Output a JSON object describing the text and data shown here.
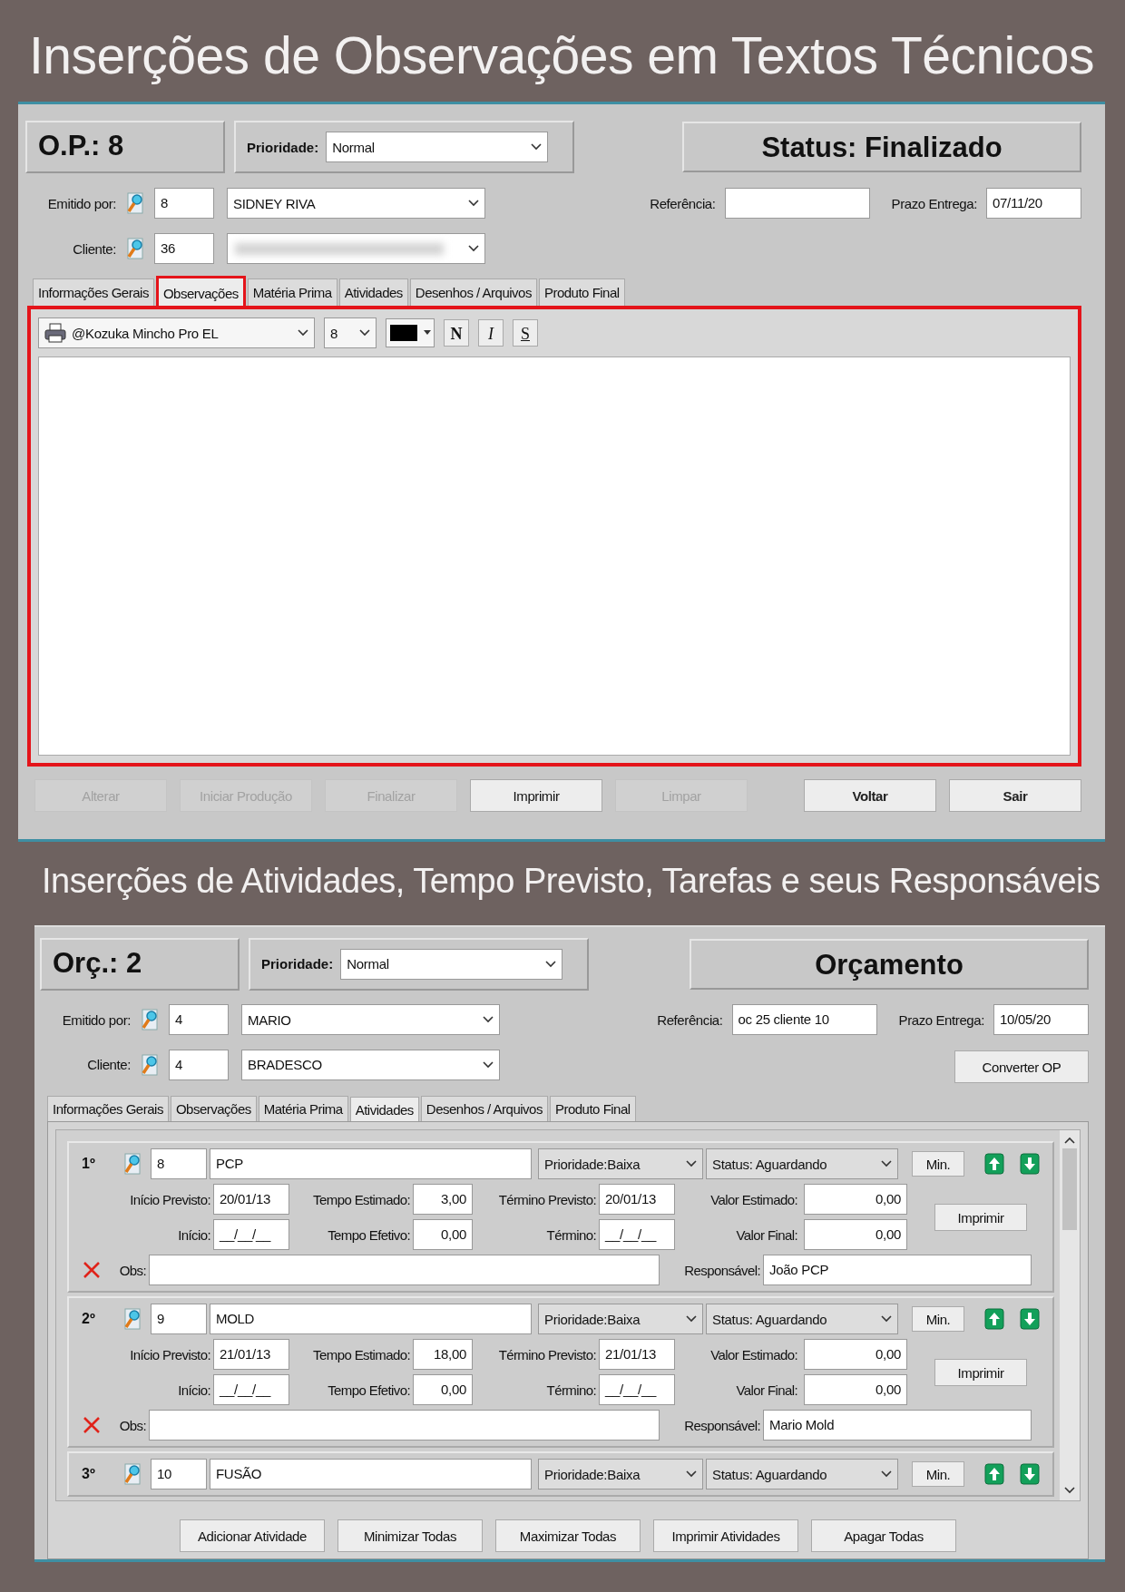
{
  "headline_top": "Inserções de Observações em Textos Técnicos",
  "order_window": {
    "number": "O.P.: 8",
    "priority": {
      "label": "Prioridade:",
      "value": "Normal"
    },
    "status": "Status: Finalizado",
    "issued_by": {
      "label": "Emitido por:",
      "code": "8",
      "name": "SIDNEY RIVA"
    },
    "client": {
      "label": "Cliente:",
      "code": "36",
      "blurred": true
    },
    "reference": {
      "label": "Referência:"
    },
    "deadline": {
      "label": "Prazo Entrega:",
      "value": "07/11/20"
    },
    "tabs": [
      {
        "label": "Informações Gerais",
        "selected": false,
        "highlighted": false
      },
      {
        "label": "Observações",
        "selected": true,
        "highlighted": true
      },
      {
        "label": "Matéria Prima",
        "selected": false,
        "highlighted": false
      },
      {
        "label": "Atividades",
        "selected": false,
        "highlighted": false
      },
      {
        "label": "Desenhos / Arquivos",
        "selected": false,
        "highlighted": false
      },
      {
        "label": "Produto Final",
        "selected": false,
        "highlighted": false
      }
    ],
    "editor": {
      "highlighted": true,
      "font": "@Kozuka Mincho Pro EL",
      "size": "8",
      "format_buttons": [
        {
          "label": "N",
          "kind": "bold"
        },
        {
          "label": "I",
          "kind": "italic"
        },
        {
          "label": "S",
          "kind": "underline"
        }
      ]
    },
    "buttons": [
      {
        "label": "Alterar",
        "disabled": true,
        "kind": "action"
      },
      {
        "label": "Iniciar Produção",
        "disabled": true,
        "kind": "action"
      },
      {
        "label": "Finalizar",
        "disabled": true,
        "kind": "action"
      },
      {
        "label": "Imprimir",
        "disabled": false,
        "kind": "action"
      },
      {
        "label": "Limpar",
        "disabled": true,
        "kind": "action"
      },
      {
        "label": "Voltar",
        "disabled": false,
        "kind": "navigation"
      },
      {
        "label": "Sair",
        "disabled": false,
        "kind": "navigation"
      }
    ]
  },
  "headline_bottom": "Inserções de Atividades, Tempo Previsto, Tarefas e seus Responsáveis",
  "budget_window": {
    "number": "Orç.: 2",
    "priority": {
      "label": "Prioridade:",
      "value": "Normal"
    },
    "status": "Orçamento",
    "issued_by": {
      "label": "Emitido por:",
      "code": "4",
      "name": "MARIO"
    },
    "client": {
      "label": "Cliente:",
      "code": "4",
      "name": "BRADESCO"
    },
    "reference": {
      "label": "Referência:",
      "value": "oc 25 cliente 10"
    },
    "deadline": {
      "label": "Prazo Entrega:",
      "value": "10/05/20"
    },
    "convert_button": "Converter OP",
    "tabs": [
      {
        "label": "Informações Gerais",
        "selected": false
      },
      {
        "label": "Observações",
        "selected": false
      },
      {
        "label": "Matéria Prima",
        "selected": false
      },
      {
        "label": "Atividades",
        "selected": true
      },
      {
        "label": "Desenhos / Arquivos",
        "selected": false
      },
      {
        "label": "Produto Final",
        "selected": false
      }
    ],
    "activities": [
      {
        "ordinal": "1º",
        "code": "8",
        "name": "PCP",
        "priority": "Prioridade:Baixa",
        "status": "Status: Aguardando",
        "min_button": "Min.",
        "details": {
          "planned_start": {
            "label": "Início Previsto:",
            "value": "20/01/13"
          },
          "estimated_time": {
            "label": "Tempo Estimado:",
            "value": "3,00"
          },
          "planned_end": {
            "label": "Término Previsto:",
            "value": "20/01/13"
          },
          "estimated_value": {
            "label": "Valor Estimado:",
            "value": "0,00"
          },
          "start": {
            "label": "Início:",
            "value": "__/__/__"
          },
          "effective_time": {
            "label": "Tempo Efetivo:",
            "value": "0,00"
          },
          "end": {
            "label": "Término:",
            "value": "__/__/__"
          },
          "final_value": {
            "label": "Valor Final:",
            "value": "0,00"
          },
          "print_button": "Imprimir",
          "obs": {
            "label": "Obs:"
          },
          "responsible": {
            "label": "Responsável:",
            "value": "João PCP"
          }
        }
      },
      {
        "ordinal": "2º",
        "code": "9",
        "name": "MOLD",
        "priority": "Prioridade:Baixa",
        "status": "Status: Aguardando",
        "min_button": "Min.",
        "details": {
          "planned_start": {
            "label": "Início Previsto:",
            "value": "21/01/13"
          },
          "estimated_time": {
            "label": "Tempo Estimado:",
            "value": "18,00"
          },
          "planned_end": {
            "label": "Término Previsto:",
            "value": "21/01/13"
          },
          "estimated_value": {
            "label": "Valor Estimado:",
            "value": "0,00"
          },
          "start": {
            "label": "Início:",
            "value": "__/__/__"
          },
          "effective_time": {
            "label": "Tempo Efetivo:",
            "value": "0,00"
          },
          "end": {
            "label": "Término:",
            "value": "__/__/__"
          },
          "final_value": {
            "label": "Valor Final:",
            "value": "0,00"
          },
          "print_button": "Imprimir",
          "obs": {
            "label": "Obs:"
          },
          "responsible": {
            "label": "Responsável:",
            "value": "Mario Mold"
          }
        }
      },
      {
        "ordinal": "3º",
        "code": "10",
        "name": "FUSÃO",
        "priority": "Prioridade:Baixa",
        "status": "Status: Aguardando",
        "min_button": "Min."
      }
    ],
    "buttons": [
      "Adicionar Atividade",
      "Minimizar Todas",
      "Maximizar Todas",
      "Imprimir Atividades",
      "Apagar Todas"
    ]
  }
}
